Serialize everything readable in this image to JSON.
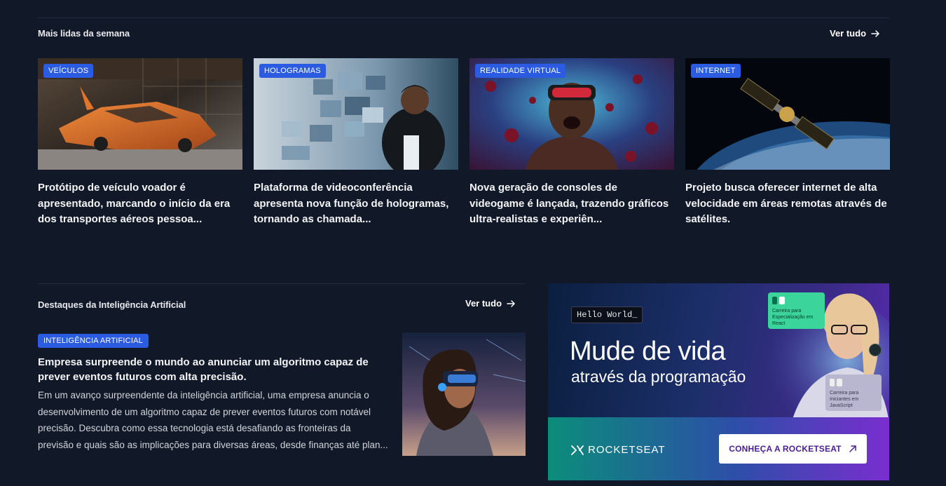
{
  "section1": {
    "title": "Mais lidas da semana",
    "see_all": "Ver tudo",
    "cards": [
      {
        "badge": "VEÍCULOS",
        "headline": "Protótipo de veículo voador é apresentado, marcando o início da era dos transportes aéreos pessoa..."
      },
      {
        "badge": "HOLOGRAMAS",
        "headline": "Plataforma de videoconferência apresenta nova função de hologramas, tornando as chamada..."
      },
      {
        "badge": "REALIDADE VIRTUAL",
        "headline": "Nova geração de consoles de videogame é lançada, trazendo gráficos ultra-realistas e experiên..."
      },
      {
        "badge": "INTERNET",
        "headline": "Projeto busca oferecer internet de alta velocidade em áreas remotas através de satélites."
      }
    ]
  },
  "section2": {
    "title": "Destaques da Inteligência Artificial",
    "see_all": "Ver tudo",
    "article": {
      "badge": "INTELIGÊNCIA ARTIFICIAL",
      "headline": "Empresa surpreende o mundo ao anunciar um algoritmo capaz de prever eventos futuros com alta precisão.",
      "body": "Em um avanço surpreendente da inteligência artificial, uma empresa anuncia o desenvolvimento de um algoritmo capaz de prever eventos futuros com notável precisão. Descubra como essa tecnologia está desafiando as fronteiras da previsão e quais são as implicações para diversas áreas, desde finanças até plan..."
    }
  },
  "ad": {
    "hello": "Hello World_",
    "headline": "Mude de vida",
    "subheadline": "através da programação",
    "brand": "ROCKETSEAT",
    "cta": "CONHEÇA A ROCKETSEAT",
    "card_react": "Carreira para Especialização em React",
    "card_js": "Carreira para Iniciantes em JavaScript",
    "colors": {
      "background": "#111827",
      "badge": "#2b5be0",
      "cta_text": "#4c1d95"
    }
  }
}
